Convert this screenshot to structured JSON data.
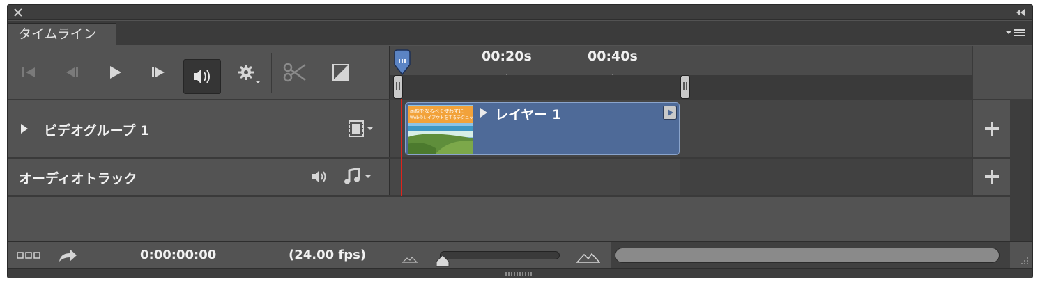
{
  "panel": {
    "tab_label": "タイムライン"
  },
  "ruler": {
    "labels": [
      "00:20s",
      "00:40s"
    ]
  },
  "tracks": {
    "video": {
      "label": "ビデオグループ 1"
    },
    "audio": {
      "label": "オーディオトラック"
    }
  },
  "clip": {
    "label": "レイヤー 1",
    "thumbnail_text": [
      "画像をなるべく使わずに",
      "Webのレイアウトをするテクニック"
    ]
  },
  "footer": {
    "timecode": "0:00:00:00",
    "fps": "(24.00 fps)"
  },
  "colors": {
    "panel_bg": "#535353",
    "clip_fill": "#4e6a98",
    "playhead": "#e0241b",
    "playhead_marker": "#5b84c4"
  },
  "icons": [
    "close-icon",
    "collapse-icon",
    "panel-menu-icon",
    "go-to-first-frame-icon",
    "previous-frame-icon",
    "play-icon",
    "next-frame-icon",
    "audio-mute-icon",
    "settings-gear-icon",
    "scissors-icon",
    "transition-icon",
    "expand-triangle-icon",
    "film-strip-icon",
    "speaker-icon",
    "music-note-icon",
    "add-icon",
    "render-icon",
    "zoom-out-mountain-icon",
    "zoom-in-mountain-icon"
  ],
  "zoom_slider_level": 0.0
}
